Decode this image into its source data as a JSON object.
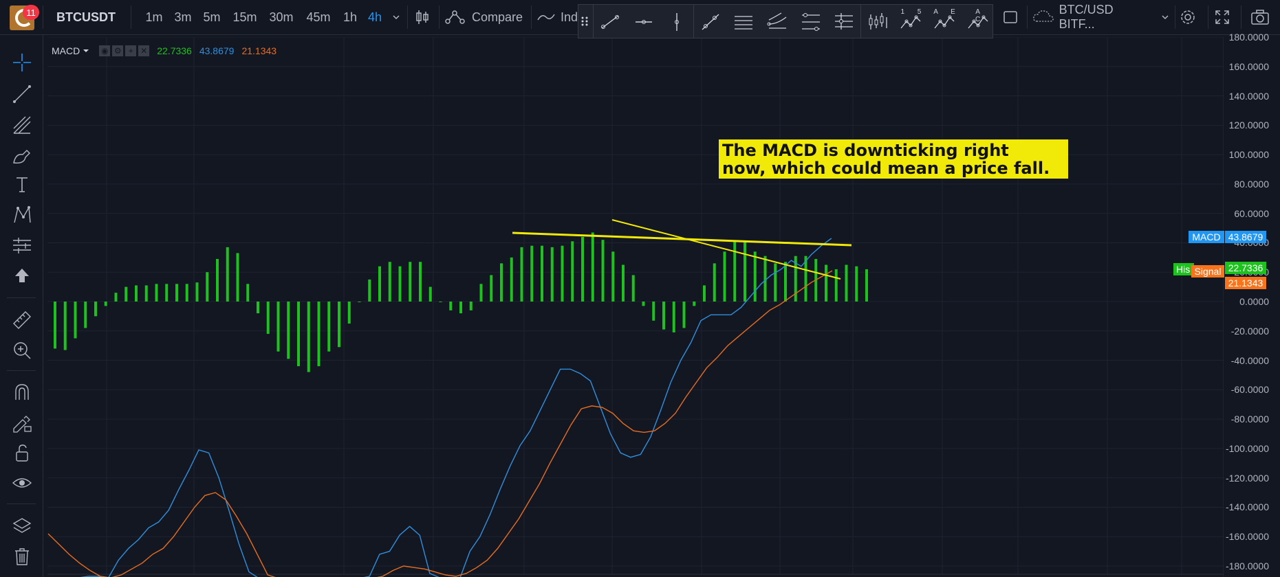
{
  "header": {
    "avatar_badge": "11",
    "symbol": "BTCUSDT",
    "intervals": [
      "1m",
      "3m",
      "5m",
      "15m",
      "30m",
      "45m",
      "1h",
      "4h"
    ],
    "active_interval": "4h",
    "compare_label": "Compare",
    "indicators_label": "Ind",
    "datasource": "BTC/USD BITF...",
    "icons": [
      "candles-icon",
      "compare-icon",
      "indicators-icon",
      "rectangle-icon",
      "cloud-icon",
      "settings-icon",
      "fullscreen-icon",
      "camera-icon"
    ]
  },
  "drawing_toolbar": {
    "tools": [
      {
        "name": "trend-line-icon",
        "label": ""
      },
      {
        "name": "horizontal-line-icon",
        "label": ""
      },
      {
        "name": "vertical-line-icon",
        "label": ""
      },
      {
        "name": "ray-icon",
        "label": ""
      },
      {
        "name": "parallel-channel-icon",
        "label": ""
      },
      {
        "name": "pitchfork-icon",
        "label": ""
      },
      {
        "name": "fib-retracement-icon",
        "label": ""
      },
      {
        "name": "fib-extension-icon",
        "label": ""
      },
      {
        "name": "gann-icon",
        "label": ""
      },
      {
        "name": "elliott-impulse-icon",
        "label": "1 5"
      },
      {
        "name": "elliott-abcde-icon",
        "label": "A E"
      },
      {
        "name": "elliott-abc-icon",
        "label": "A C"
      }
    ]
  },
  "sidebar": {
    "tools": [
      "crosshair-icon",
      "line-icon",
      "fib-icon",
      "brush-icon",
      "text-icon",
      "pattern-icon",
      "measure-icon",
      "arrow-up-icon",
      "ruler-icon",
      "zoom-in-icon",
      "magnet-icon",
      "lock-drawing-icon",
      "unlock-icon",
      "eye-icon",
      "layers-icon",
      "trash-icon"
    ]
  },
  "indicator_legend": {
    "title": "MACD",
    "values": [
      {
        "text": "22.7336",
        "color": "#1ec21e"
      },
      {
        "text": "43.8679",
        "color": "#2f8fde"
      },
      {
        "text": "21.1343",
        "color": "#e86d1f"
      }
    ]
  },
  "annotation": {
    "line1": "The MACD is downticking right",
    "line2": "now, which could mean a price fall."
  },
  "price_axis": {
    "labels": [
      "180.0000",
      "160.0000",
      "140.0000",
      "120.0000",
      "100.0000",
      "80.0000",
      "60.0000",
      "40.0000",
      "20.0000",
      "0.0000",
      "-20.0000",
      "-40.0000",
      "-60.0000",
      "-80.0000",
      "-100.0000",
      "-120.0000",
      "-140.0000",
      "-160.0000",
      "-180.0000"
    ],
    "macd_tag": {
      "label": "MACD",
      "value": "43.8679",
      "color": "#2196f3"
    },
    "hist_tag": {
      "label": "His",
      "value": "22.7336",
      "color": "#1ec21e"
    },
    "signal_tag": {
      "label": "Signal",
      "value": "21.1343",
      "color": "#f7731c"
    }
  },
  "chart_data": {
    "type": "line",
    "ylim": [
      -185,
      183
    ],
    "histogram": [
      -32,
      -33,
      -25,
      -18,
      -10,
      -3,
      6,
      10,
      11,
      11,
      12,
      12,
      12,
      12,
      13,
      20,
      29,
      37,
      33,
      12,
      -8,
      -22,
      -34,
      -39,
      -44,
      -48,
      -44,
      -34,
      -31,
      -15,
      0,
      15,
      24,
      27,
      24,
      27,
      27,
      10,
      0,
      -6,
      -8,
      -6,
      12,
      18,
      26,
      30,
      37,
      38,
      38,
      37,
      38,
      41,
      44,
      47,
      42,
      34,
      25,
      18,
      -3,
      -13,
      -19,
      -21,
      -18,
      -3,
      11,
      26,
      34,
      41,
      41,
      34,
      31,
      26,
      27,
      31,
      31,
      29,
      25,
      22,
      25,
      24,
      22
    ],
    "series": [
      {
        "name": "MACD",
        "values": [
          -190,
          -190,
          -189,
          -188,
          -187,
          -187,
          -188,
          -176,
          -168,
          -162,
          -154,
          -150,
          -142,
          -128,
          -115,
          -101,
          -103,
          -120,
          -142,
          -165,
          -184,
          -190,
          -190,
          -190,
          -190,
          -190,
          -190,
          -190,
          -190,
          -190,
          -190,
          -190,
          -187,
          -172,
          -170,
          -159,
          -153,
          -159,
          -185,
          -188,
          -190,
          -190,
          -170,
          -160,
          -145,
          -128,
          -112,
          -98,
          -88,
          -74,
          -60,
          -46,
          -46,
          -49,
          -54,
          -72,
          -90,
          -103,
          -106,
          -104,
          -92,
          -74,
          -55,
          -40,
          -28,
          -13,
          -9,
          -9,
          -9,
          -4,
          4,
          12,
          18,
          22,
          28,
          24,
          32,
          38,
          43
        ]
      },
      {
        "name": "Signal",
        "values": [
          -158,
          -165,
          -172,
          -178,
          -183,
          -187,
          -188,
          -186,
          -182,
          -178,
          -172,
          -168,
          -160,
          -150,
          -140,
          -132,
          -130,
          -135,
          -146,
          -158,
          -172,
          -186,
          -190,
          -190,
          -190,
          -190,
          -190,
          -190,
          -190,
          -190,
          -190,
          -190,
          -187,
          -183,
          -180,
          -181,
          -182,
          -184,
          -186,
          -187,
          -185,
          -181,
          -176,
          -168,
          -158,
          -148,
          -136,
          -124,
          -110,
          -97,
          -84,
          -73,
          -71,
          -72,
          -76,
          -83,
          -88,
          -89,
          -88,
          -83,
          -76,
          -65,
          -55,
          -45,
          -38,
          -30,
          -24,
          -18,
          -12,
          -6,
          -2,
          3,
          8,
          13,
          17,
          21
        ]
      }
    ],
    "trendlines": [
      {
        "from": [
          0,
          47
        ],
        "to": [
          1,
          38
        ]
      },
      {
        "from": [
          0,
          56
        ],
        "to": [
          1,
          15
        ]
      }
    ]
  }
}
